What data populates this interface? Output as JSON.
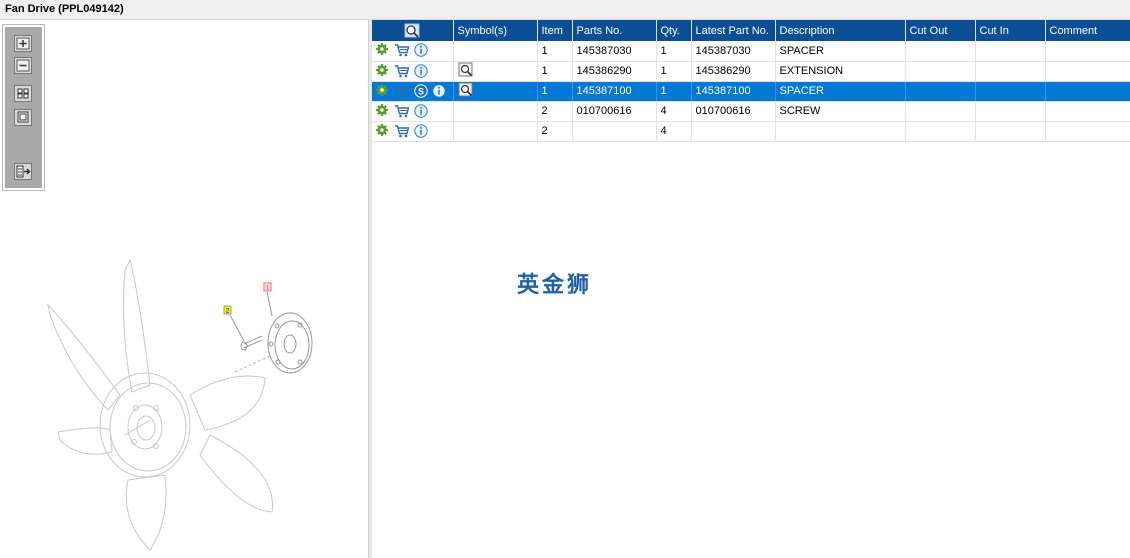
{
  "window": {
    "title": "Fan Drive (PPL049142)"
  },
  "toolbox": {
    "tools": [
      {
        "name": "zoom-in-icon"
      },
      {
        "name": "zoom-out-icon"
      },
      {
        "name": "fit-all-icon"
      },
      {
        "name": "fit-window-icon"
      },
      {
        "name": "toggle-list-icon"
      }
    ]
  },
  "diagram": {
    "callouts": [
      {
        "label": "2",
        "color": "#f5f500"
      },
      {
        "label": "1",
        "color": "#ff6b6b"
      }
    ]
  },
  "parts_table": {
    "columns": [
      "",
      "Symbol(s)",
      "Item",
      "Parts No.",
      "Qty.",
      "Latest Part No.",
      "Description",
      "Cut Out",
      "Cut In",
      "Comment"
    ],
    "rows": [
      {
        "item": "1",
        "part_no": "145387030",
        "qty": "1",
        "latest": "145387030",
        "description": "SPACER",
        "cut_out": "",
        "cut_in": "",
        "comment": "",
        "symbol": false,
        "supersede": false,
        "selected": false
      },
      {
        "item": "1",
        "part_no": "145386290",
        "qty": "1",
        "latest": "145386290",
        "description": "EXTENSION",
        "cut_out": "",
        "cut_in": "",
        "comment": "",
        "symbol": true,
        "supersede": false,
        "selected": false
      },
      {
        "item": "1",
        "part_no": "145387100",
        "qty": "1",
        "latest": "145387100",
        "description": "SPACER",
        "cut_out": "",
        "cut_in": "",
        "comment": "",
        "symbol": true,
        "supersede": true,
        "selected": true
      },
      {
        "item": "2",
        "part_no": "010700616",
        "qty": "4",
        "latest": "010700616",
        "description": "SCREW",
        "cut_out": "",
        "cut_in": "",
        "comment": "",
        "symbol": false,
        "supersede": false,
        "selected": false
      },
      {
        "item": "2",
        "part_no": "",
        "qty": "4",
        "latest": "",
        "description": "",
        "cut_out": "",
        "cut_in": "",
        "comment": "",
        "symbol": false,
        "supersede": false,
        "selected": false
      }
    ]
  },
  "watermark": {
    "text": "英金狮"
  },
  "colors": {
    "header": "#0a4f96",
    "selected_row": "#0079d6",
    "gear": "#5a9e2f",
    "info": "#2b7fc7"
  }
}
